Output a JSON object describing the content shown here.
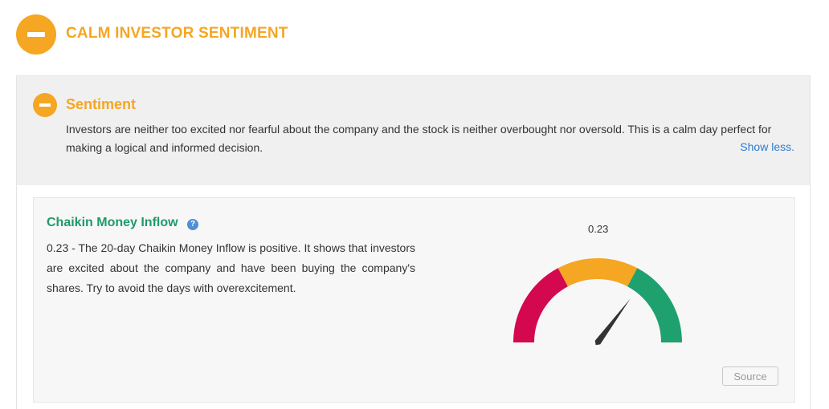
{
  "header": {
    "title": "CALM INVESTOR SENTIMENT",
    "icon": "minus-circle-icon",
    "accent_color": "#f5a623"
  },
  "sentiment": {
    "title": "Sentiment",
    "icon": "minus-circle-icon",
    "description": "Investors are neither too excited nor fearful about the company and the stock is neither overbought nor oversold. This is a calm day perfect for making a logical and informed decision.",
    "toggle_label": "Show less."
  },
  "cmf": {
    "title": "Chaikin Money Inflow",
    "help_icon": "question-circle-icon",
    "help_glyph": "?",
    "description": "0.23 - The 20-day Chaikin Money Inflow is positive. It shows that investors are excited about the company and have been buying the company's shares. Try to avoid the days with overexcitement.",
    "gauge_value_label": "0.23",
    "gauge": {
      "value": 0.23,
      "min": -1,
      "max": 1,
      "colors": {
        "negative": "#d4084e",
        "neutral": "#f5a623",
        "positive": "#1fa06f"
      }
    },
    "source_label": "Source"
  }
}
